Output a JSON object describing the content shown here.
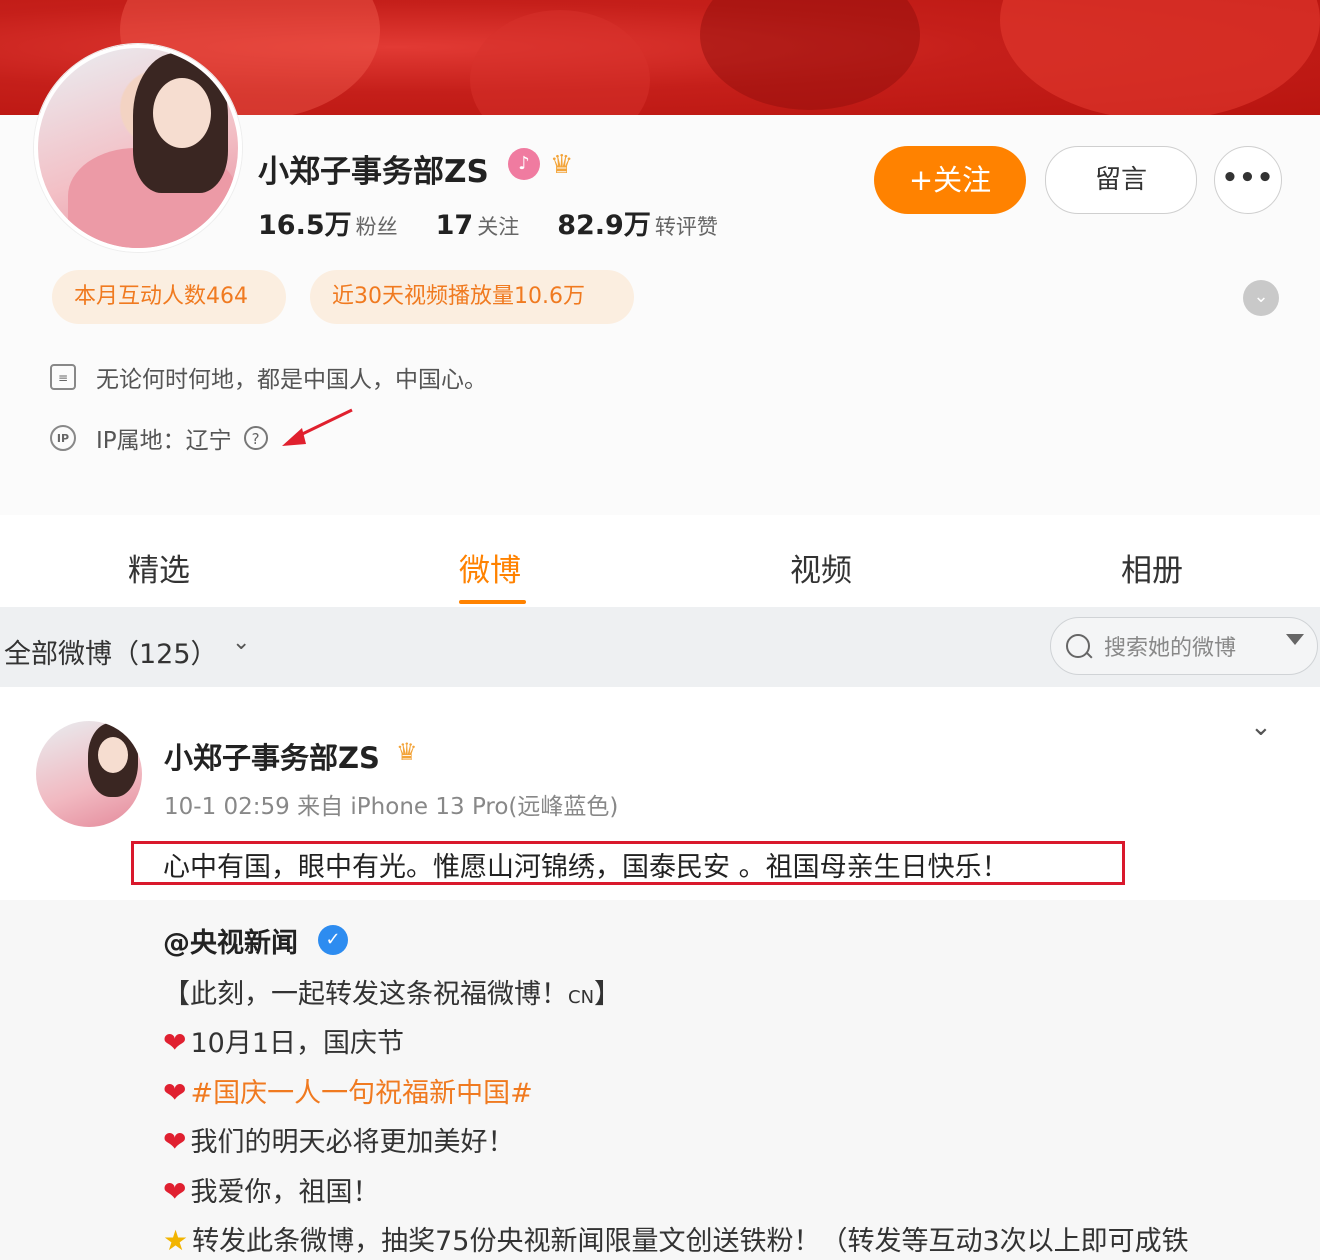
{
  "profile": {
    "name": "小郑子事务部ZS",
    "stats": [
      {
        "num": "16.5万",
        "label": "粉丝"
      },
      {
        "num": "17",
        "label": "关注"
      },
      {
        "num": "82.9万",
        "label": "转评赞"
      }
    ],
    "follow_label": "+关注",
    "message_label": "留言",
    "more_label": "•••",
    "tags": [
      "本月互动人数464",
      "近30天视频播放量10.6万"
    ],
    "bio": "无论何时何地，都是中国人，中国心。",
    "ip": "IP属地：辽宁"
  },
  "tabs": [
    "精选",
    "微博",
    "视频",
    "相册"
  ],
  "active_tab": "微博",
  "filter": {
    "label": "全部微博（125）",
    "search_placeholder": "搜索她的微博"
  },
  "post": {
    "author": "小郑子事务部ZS",
    "meta": "10-1 02:59 来自 iPhone 13 Pro(远峰蓝色)",
    "text": "心中有国，眼中有光。惟愿山河锦绣，国泰民安 。祖国母亲生日快乐！",
    "repost": {
      "author": "@央视新闻",
      "line1_a": "【此刻，一起转发这条祝福微博！",
      "line1_cn": "CN",
      "line1_b": "】",
      "line2": "10月1日，国庆节",
      "line3_topic": "#国庆一人一句祝福新中国#",
      "line4": "我们的明天必将更加美好！",
      "line5": "我爱你，祖国！",
      "line6": "转发此条微博，抽奖75份央视新闻限量文创送铁粉！（转发等互动3次以上即可成铁"
    }
  },
  "colors": {
    "accent": "#ff8200",
    "highlight_box": "#d9182c",
    "verified": "#2d8cf0"
  },
  "icons": [
    "bio-icon",
    "ip-icon",
    "help-icon",
    "search-icon",
    "heart-icon",
    "star-icon",
    "crown-icon",
    "verified-icon"
  ]
}
